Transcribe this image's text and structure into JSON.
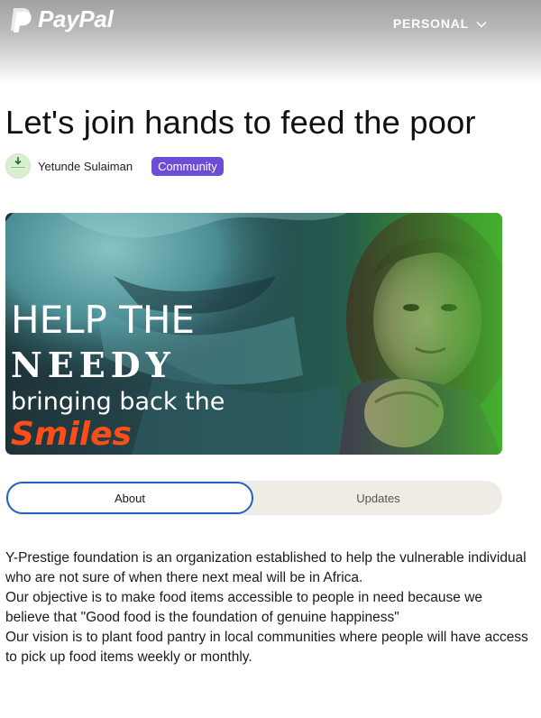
{
  "header": {
    "brand": "PayPal",
    "nav_label": "PERSONAL"
  },
  "campaign": {
    "title": "Let's join hands to feed the poor",
    "author": "Yetunde Sulaiman",
    "category": "Community"
  },
  "hero": {
    "line1": "HELP THE",
    "line2": "NEEDY",
    "line3": "bringing back the",
    "line4": "Smiles"
  },
  "tabs": [
    {
      "label": "About",
      "selected": true
    },
    {
      "label": "Updates",
      "selected": false
    }
  ],
  "description": [
    "Y-Prestige foundation is an organization established to help the vulnerable individual who are not sure of when there next meal will be in Africa.",
    "Our objective is to make food items accessible to people in need because we believe that \"Good food is the foundation of genuine happiness\"",
    "Our vision is to plant food pantry in local communities where people will have access to pick up food items weekly or monthly."
  ],
  "colors": {
    "accent": "#1f63c9",
    "badge": "#6c4dd6",
    "hero_highlight": "#ff4d1a"
  }
}
